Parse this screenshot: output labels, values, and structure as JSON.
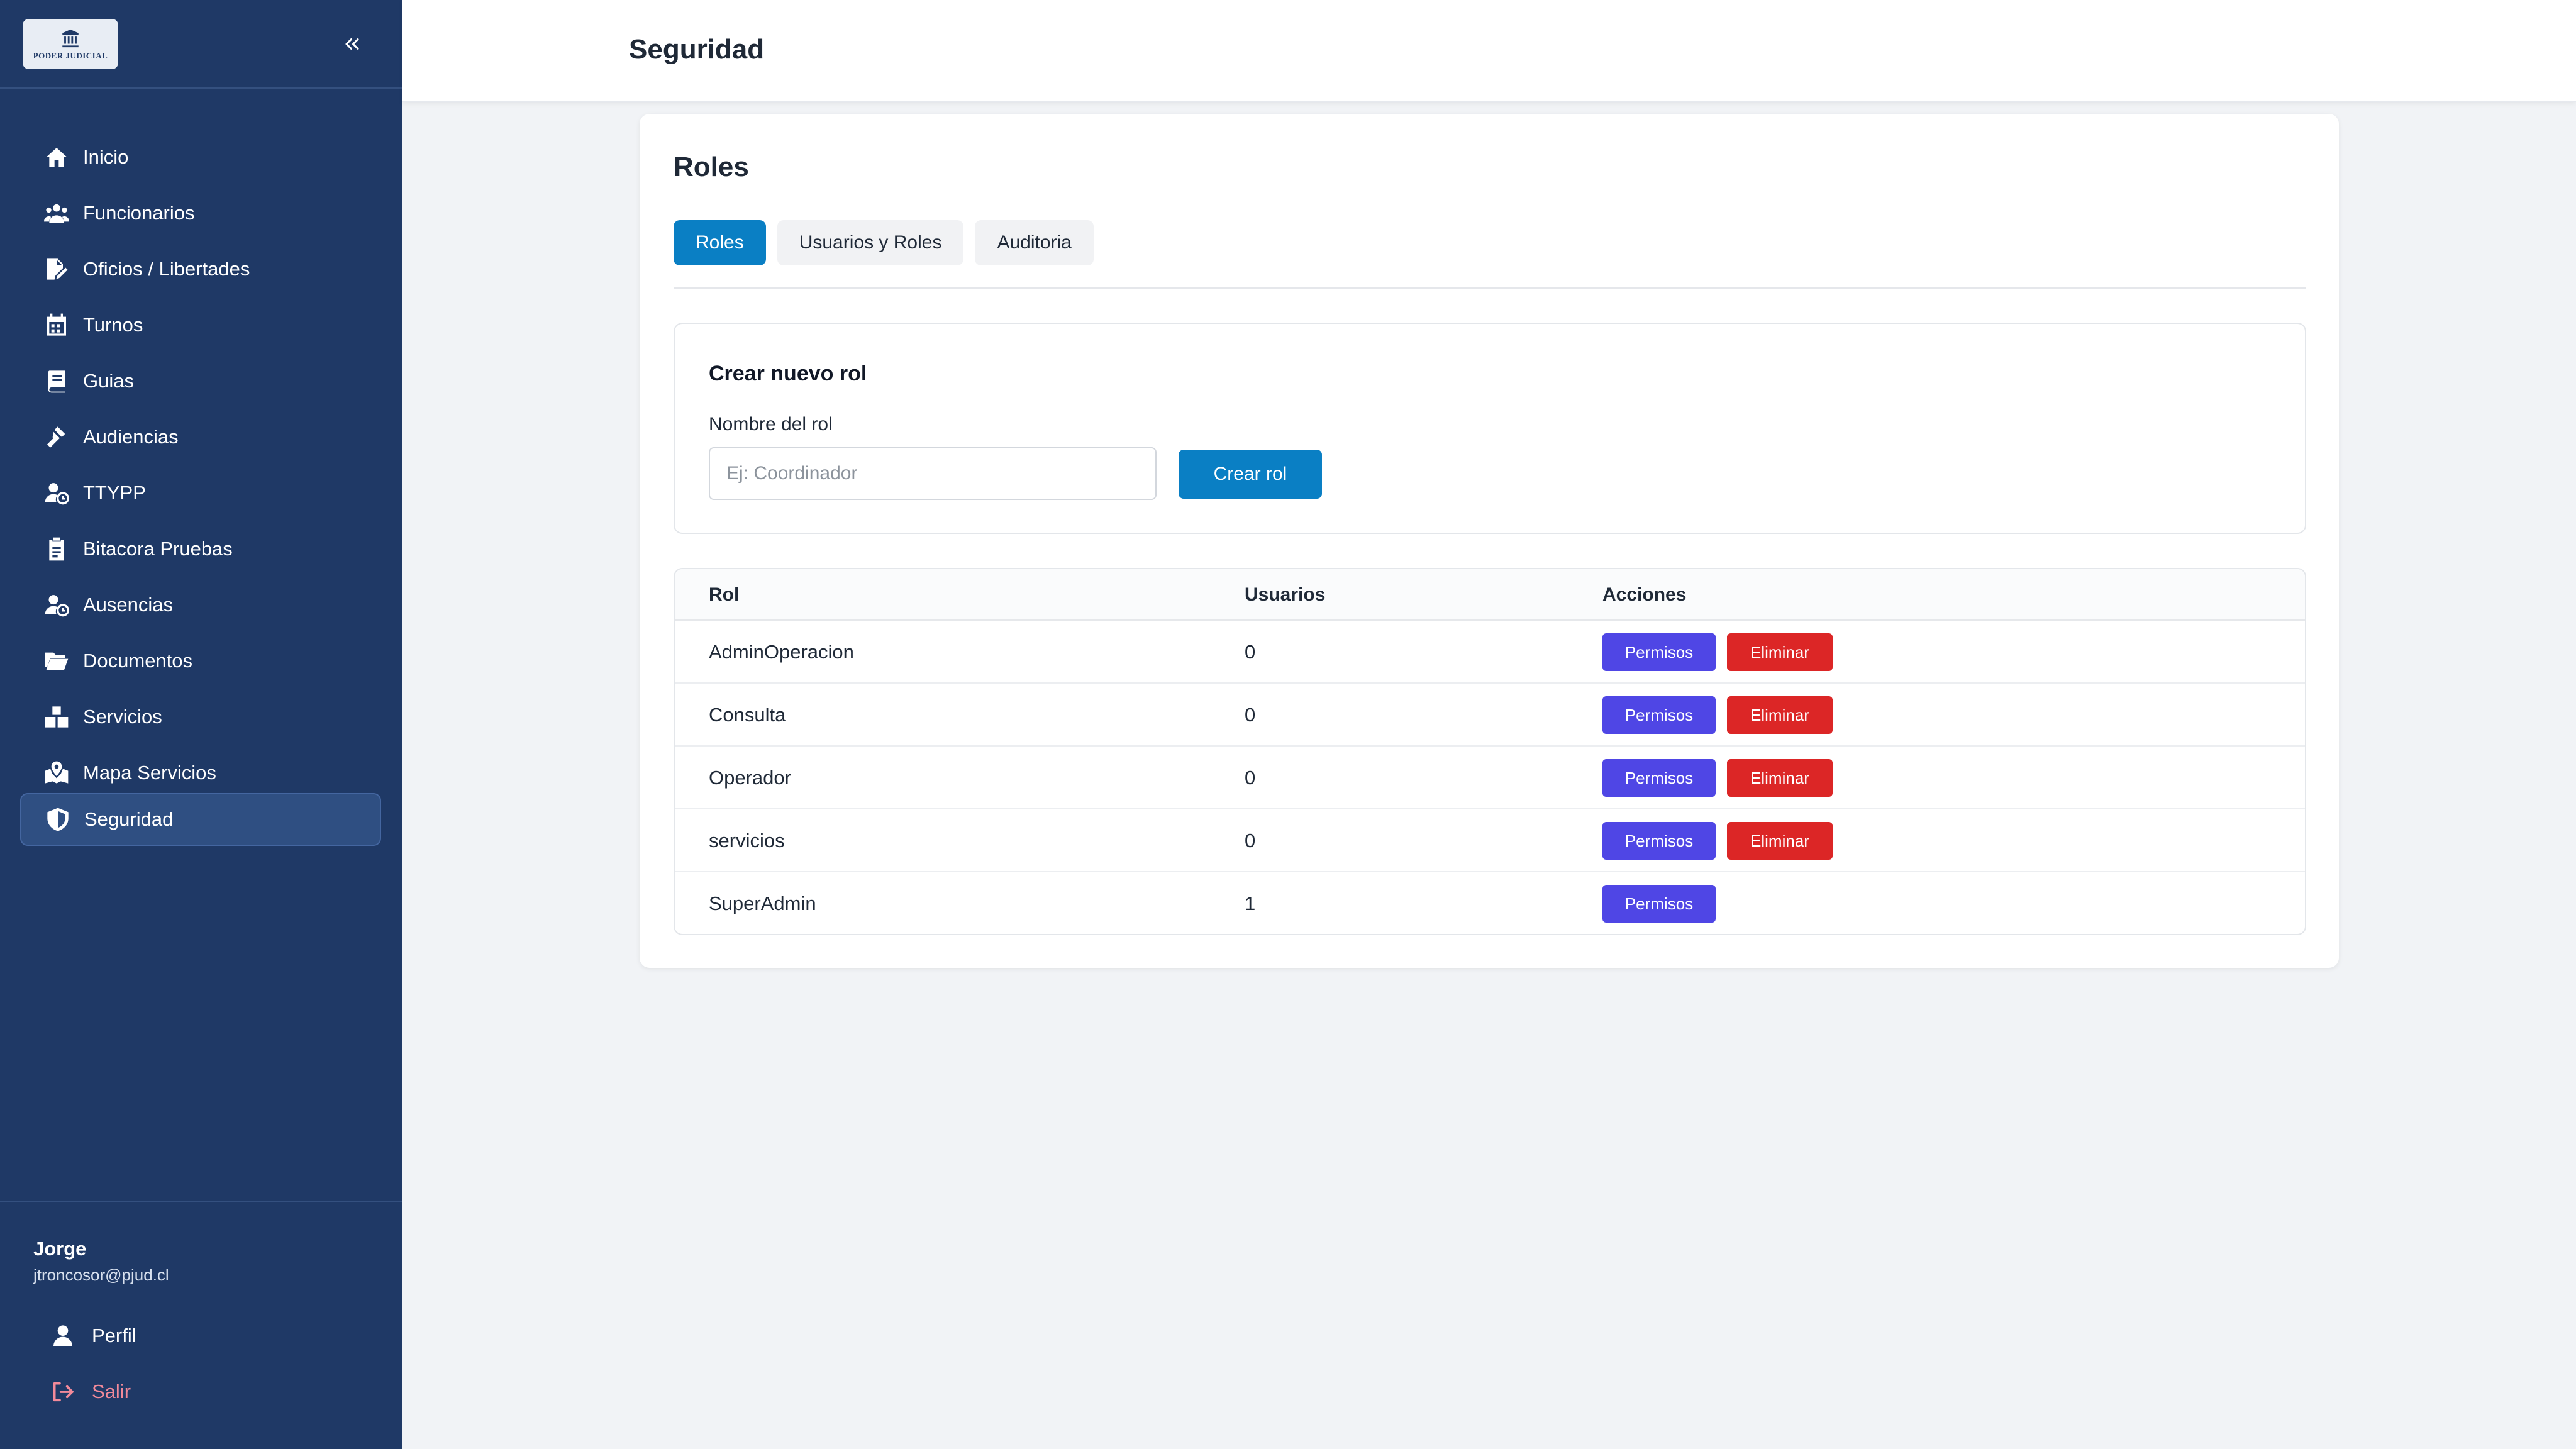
{
  "sidebar": {
    "logo_text": "PODER JUDICIAL",
    "nav": [
      {
        "label": "Inicio",
        "icon": "home-icon"
      },
      {
        "label": "Funcionarios",
        "icon": "users-icon"
      },
      {
        "label": "Oficios / Libertades",
        "icon": "file-signature-icon"
      },
      {
        "label": "Turnos",
        "icon": "calendar-icon"
      },
      {
        "label": "Guias",
        "icon": "book-icon"
      },
      {
        "label": "Audiencias",
        "icon": "gavel-icon"
      },
      {
        "label": "TTYPP",
        "icon": "user-clock-icon"
      },
      {
        "label": "Bitacora Pruebas",
        "icon": "clipboard-icon"
      },
      {
        "label": "Ausencias",
        "icon": "user-clock-icon"
      },
      {
        "label": "Documentos",
        "icon": "folder-open-icon"
      },
      {
        "label": "Servicios",
        "icon": "boxes-icon"
      },
      {
        "label": "Mapa Servicios",
        "icon": "map-marked-icon"
      },
      {
        "label": "Seguridad",
        "icon": "shield-icon",
        "active": true
      }
    ],
    "user": {
      "name": "Jorge",
      "email": "jtroncosor@pjud.cl"
    },
    "profile_label": "Perfil",
    "logout_label": "Salir"
  },
  "header": {
    "title": "Seguridad"
  },
  "card": {
    "title": "Roles",
    "tabs": [
      {
        "label": "Roles",
        "active": true
      },
      {
        "label": "Usuarios y Roles",
        "active": false
      },
      {
        "label": "Auditoria",
        "active": false
      }
    ],
    "create": {
      "title": "Crear nuevo rol",
      "field_label": "Nombre del rol",
      "placeholder": "Ej: Coordinador",
      "value": "",
      "button_label": "Crear rol"
    },
    "table": {
      "headers": [
        "Rol",
        "Usuarios",
        "Acciones"
      ],
      "permisos_label": "Permisos",
      "eliminar_label": "Eliminar",
      "rows": [
        {
          "rol": "AdminOperacion",
          "usuarios": "0",
          "deletable": true
        },
        {
          "rol": "Consulta",
          "usuarios": "0",
          "deletable": true
        },
        {
          "rol": "Operador",
          "usuarios": "0",
          "deletable": true
        },
        {
          "rol": "servicios",
          "usuarios": "0",
          "deletable": true
        },
        {
          "rol": "SuperAdmin",
          "usuarios": "1",
          "deletable": false
        }
      ]
    }
  },
  "colors": {
    "sidebar_bg": "#1f3966",
    "accent": "#0a7fc4",
    "permisos": "#4f46e5",
    "eliminar": "#dc2626",
    "logout": "#f28a9a"
  }
}
